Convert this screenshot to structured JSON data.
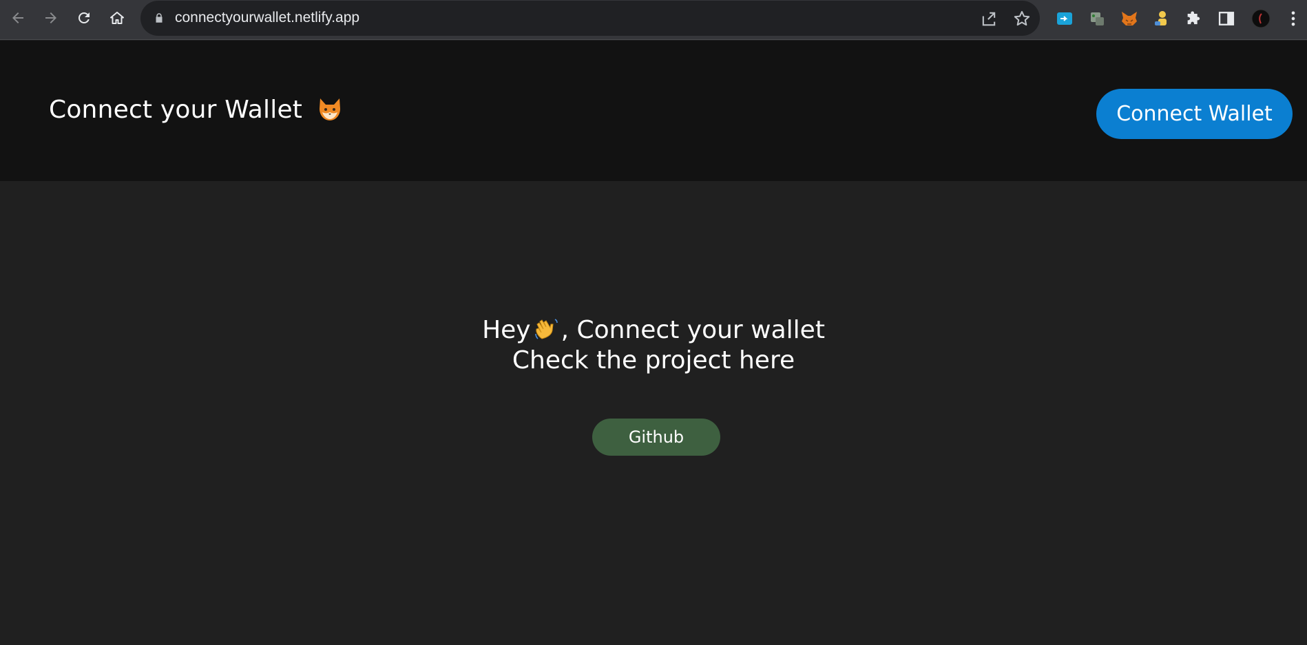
{
  "browser": {
    "url": "connectyourwallet.netlify.app",
    "icons": {
      "back": "arrow-left-icon",
      "forward": "arrow-right-icon",
      "reload": "reload-icon",
      "home": "home-icon",
      "lock": "lock-icon",
      "share": "share-icon",
      "bookmark": "star-icon",
      "extensions": "puzzle-icon",
      "side_panel": "side-panel-icon",
      "menu": "kebab-menu-icon"
    }
  },
  "header": {
    "title": "Connect your Wallet",
    "title_emoji": "fox-emoji",
    "connect_button": "Connect Wallet",
    "background": "#121212",
    "button_color": "#0b7fd1"
  },
  "hero": {
    "line1_before": "Hey",
    "line1_emoji": "waving-hand-emoji",
    "line1_after": ", Connect your wallet",
    "line2": "Check the project here",
    "github_button": "Github",
    "github_color": "#3e6040",
    "background": "#202020"
  }
}
